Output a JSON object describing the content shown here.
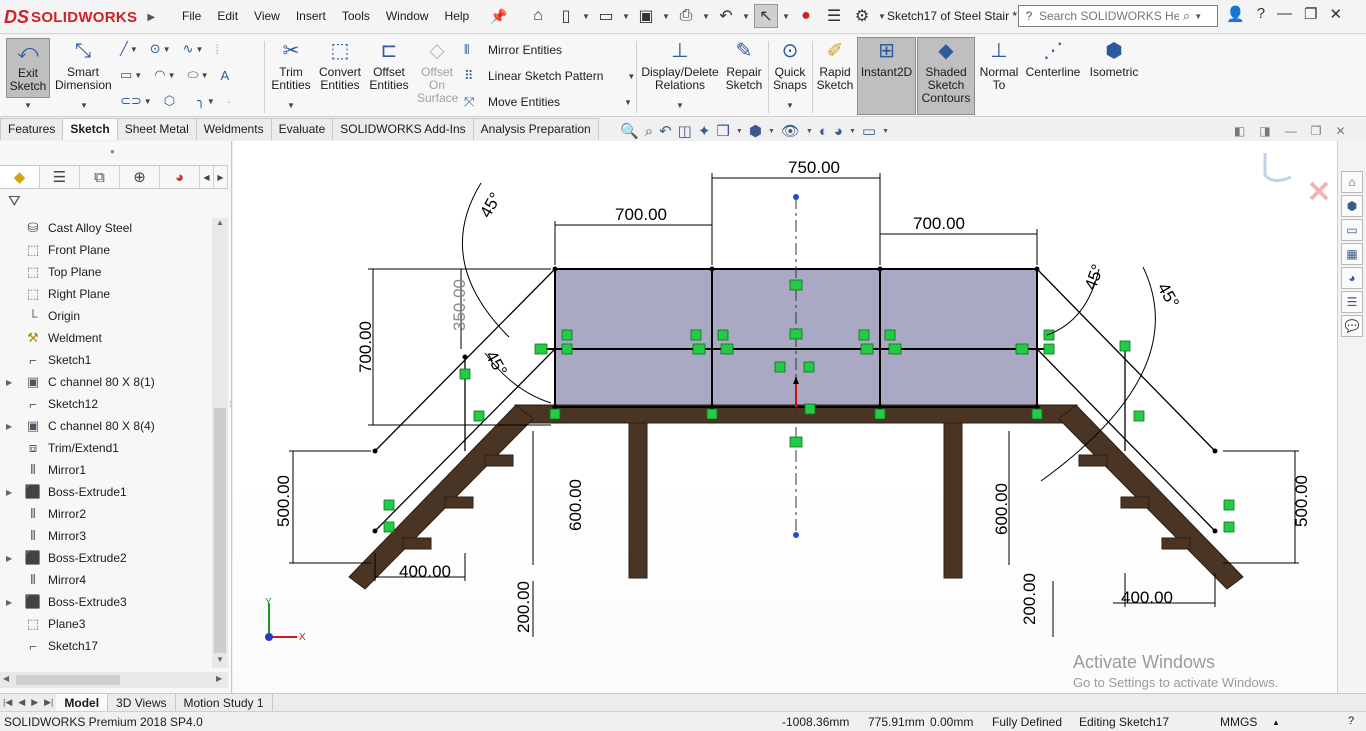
{
  "app": {
    "logo_ds": "DS",
    "logo_name": "SOLIDWORKS",
    "doc_title": "Sketch17 of Steel Stair *"
  },
  "menu": [
    "File",
    "Edit",
    "View",
    "Insert",
    "Tools",
    "Window",
    "Help"
  ],
  "search": {
    "placeholder": "Search SOLIDWORKS Help"
  },
  "ribbon": {
    "exit_sketch": "Exit Sketch",
    "smart_dimension": "Smart Dimension",
    "trim_entities": "Trim Entities",
    "convert_entities": "Convert Entities",
    "offset_entities": "Offset Entities",
    "offset_on_surface": "Offset On Surface",
    "mirror_entities": "Mirror Entities",
    "linear_sketch_pattern": "Linear Sketch Pattern",
    "move_entities": "Move Entities",
    "display_delete_relations": "Display/Delete Relations",
    "repair_sketch": "Repair Sketch",
    "quick_snaps": "Quick Snaps",
    "rapid_sketch": "Rapid Sketch",
    "instant2d": "Instant2D",
    "shaded_sketch_contours": "Shaded Sketch Contours",
    "normal_to": "Normal To",
    "centerline": "Centerline",
    "isometric": "Isometric"
  },
  "tabs": [
    "Features",
    "Sketch",
    "Sheet Metal",
    "Weldments",
    "Evaluate",
    "SOLIDWORKS Add-Ins",
    "Analysis Preparation"
  ],
  "tree": [
    {
      "label": "Cast Alloy Steel",
      "icon": "material-icon",
      "expand": false
    },
    {
      "label": "Front Plane",
      "icon": "plane-icon",
      "expand": false
    },
    {
      "label": "Top Plane",
      "icon": "plane-icon",
      "expand": false
    },
    {
      "label": "Right Plane",
      "icon": "plane-icon",
      "expand": false
    },
    {
      "label": "Origin",
      "icon": "origin-icon",
      "expand": false
    },
    {
      "label": "Weldment",
      "icon": "weldment-icon",
      "expand": false
    },
    {
      "label": "Sketch1",
      "icon": "sketch-icon",
      "expand": false
    },
    {
      "label": "C channel 80 X 8(1)",
      "icon": "structural-member-icon",
      "expand": true
    },
    {
      "label": "Sketch12",
      "icon": "sketch-icon",
      "expand": false
    },
    {
      "label": "C channel 80 X 8(4)",
      "icon": "structural-member-icon",
      "expand": true
    },
    {
      "label": "Trim/Extend1",
      "icon": "trim-extend-icon",
      "expand": false
    },
    {
      "label": "Mirror1",
      "icon": "mirror-icon",
      "expand": false
    },
    {
      "label": "Boss-Extrude1",
      "icon": "extrude-icon",
      "expand": true
    },
    {
      "label": "Mirror2",
      "icon": "mirror-icon",
      "expand": false
    },
    {
      "label": "Mirror3",
      "icon": "mirror-icon",
      "expand": false
    },
    {
      "label": "Boss-Extrude2",
      "icon": "extrude-icon",
      "expand": true
    },
    {
      "label": "Mirror4",
      "icon": "mirror-icon",
      "expand": false
    },
    {
      "label": "Boss-Extrude3",
      "icon": "extrude-icon",
      "expand": true
    },
    {
      "label": "Plane3",
      "icon": "plane-icon",
      "expand": false
    },
    {
      "label": "Sketch17",
      "icon": "sketch-icon",
      "expand": false
    }
  ],
  "dimensions": {
    "top": "750.00",
    "left_span": "700.00",
    "right_span": "700.00",
    "left_height": "700.00",
    "height_350": "350.00",
    "angle_top_left": "45°",
    "angle_mid_left": "45°",
    "angle_right_inner": "45°",
    "angle_right_outer": "45°",
    "left_500": "500.00",
    "right_500": "500.00",
    "left_600": "600.00",
    "right_600": "600.00",
    "left_400": "400.00",
    "right_400": "400.00",
    "left_200": "200.00",
    "right_200": "200.00"
  },
  "axes": {
    "x": "X",
    "y": "Y"
  },
  "watermark": {
    "line1": "Activate Windows",
    "line2": "Go to Settings to activate Windows."
  },
  "bottom_tabs": [
    "Model",
    "3D Views",
    "Motion Study 1"
  ],
  "status": {
    "product": "SOLIDWORKS Premium 2018 SP4.0",
    "x": "-1008.36mm",
    "y": "775.91mm",
    "z": "0.00mm",
    "definition": "Fully Defined",
    "editing": "Editing Sketch17",
    "units": "MMGS"
  },
  "colors": {
    "accent": "#2d5a9c",
    "brand": "#d12027",
    "wood": "#4a3525",
    "relation": "#22cc44",
    "fill": "#a9a9c3"
  }
}
